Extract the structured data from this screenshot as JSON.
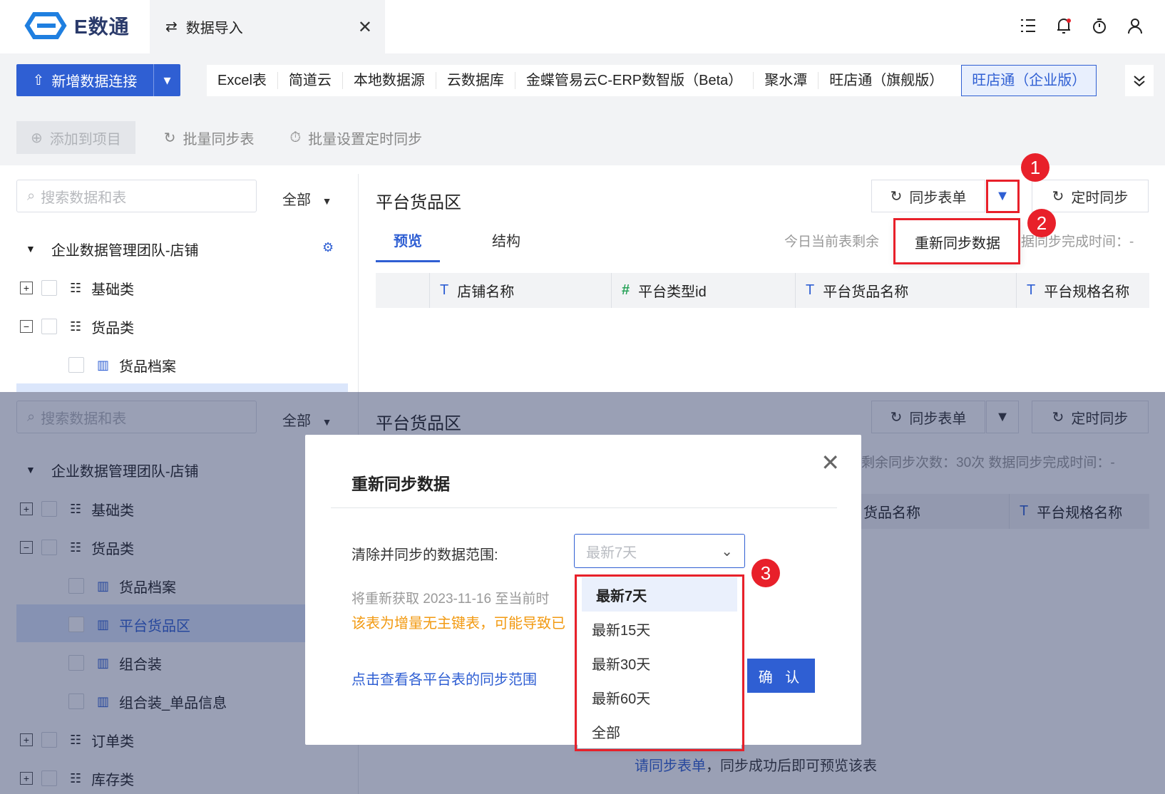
{
  "app": {
    "logo_text": "E数通"
  },
  "tab": {
    "title": "数据导入"
  },
  "row2": {
    "add_connection_label": "新增数据连接",
    "sources": [
      "Excel表",
      "简道云",
      "本地数据源",
      "云数据库",
      "金蝶管易云C-ERP数智版（Beta）",
      "聚水潭",
      "旺店通（旗舰版）"
    ],
    "active_source": "旺店通（企业版）"
  },
  "toolbar": {
    "add_to_project": "添加到项目",
    "batch_sync": "批量同步表",
    "batch_timer": "批量设置定时同步"
  },
  "left": {
    "search_placeholder": "搜索数据和表",
    "filter": "全部",
    "root": "企业数据管理团队-店铺",
    "nodes": {
      "basic": "基础类",
      "goods": "货品类",
      "goods_archive": "货品档案",
      "platform_goods": "平台货品区",
      "combo": "组合装",
      "combo_single": "组合装_单品信息",
      "orders": "订单类",
      "stock": "库存类"
    }
  },
  "right": {
    "title": "平台货品区",
    "sync_btn": "同步表单",
    "timer_btn": "定时同步",
    "tabs": [
      "预览",
      "结构"
    ],
    "info_top_left": "今日当前表剩余",
    "info_top_right": "据同步完成时间：-",
    "info_bottom": "剩余同步次数：30次   数据同步完成时间：-",
    "columns": [
      "店铺名称",
      "平台类型id",
      "平台货品名称",
      "平台规格名称"
    ],
    "col_types": [
      "T",
      "#",
      "T",
      "T"
    ],
    "bottom_col_partial": "货品名称",
    "resync_menu": "重新同步数据",
    "empty_hint_link": "请同步表单",
    "empty_hint_text": "，同步成功后即可预览该表"
  },
  "modal": {
    "title": "重新同步数据",
    "label": "清除并同步的数据范围:",
    "select_placeholder": "最新7天",
    "note1": "将重新获取 2023-11-16 至当前时",
    "note2": "该表为增量无主键表，可能导致已",
    "link": "点击查看各平台表的同步范围",
    "confirm": "确 认",
    "options": [
      "最新7天",
      "最新15天",
      "最新30天",
      "最新60天",
      "全部"
    ]
  },
  "badges": [
    "1",
    "2",
    "3"
  ],
  "colors": {
    "primary": "#2f5fd3",
    "danger": "#e8202a",
    "warning": "#f29a12"
  }
}
